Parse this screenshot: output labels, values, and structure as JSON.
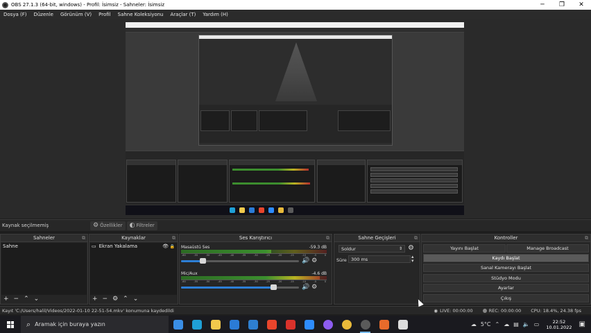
{
  "window": {
    "title": "OBS 27.1.3 (64-bit, windows) - Profil: İsimsiz - Sahneler: İsimsiz",
    "minimize": "─",
    "maximize": "❐",
    "close": "✕"
  },
  "menu": [
    "Dosya (F)",
    "Düzenle",
    "Görünüm (V)",
    "Profil",
    "Sahne Koleksiyonu",
    "Araçlar (T)",
    "Yardım (H)"
  ],
  "sources_strip": {
    "no_source": "Kaynak seçilmemiş",
    "properties": "Özellikler",
    "filters": "Filtreler"
  },
  "docks": {
    "scenes": {
      "title": "Sahneler",
      "items": [
        "Sahne"
      ]
    },
    "sources": {
      "title": "Kaynaklar",
      "items": [
        "Ekran Yakalama"
      ]
    },
    "mixer": {
      "title": "Ses Karıştırıcı",
      "channels": [
        {
          "name": "Masaüstü Ses",
          "db": "-59.3 dB",
          "level": 0.62,
          "volume": 0.18
        },
        {
          "name": "Mic/Aux",
          "db": "-4.6 dB",
          "level": 0.95,
          "volume": 0.78
        }
      ],
      "ticks": [
        "-60",
        "-55",
        "-50",
        "-45",
        "-40",
        "-35",
        "-30",
        "-25",
        "-20",
        "-15",
        "-10",
        "-5",
        "0"
      ]
    },
    "transitions": {
      "title": "Sahne Geçişleri",
      "type": "Soldur",
      "duration_label": "Süre",
      "duration": "300 ms"
    },
    "controls": {
      "title": "Kontroller",
      "start_stream": "Yayını Başlat",
      "manage_broadcast": "Manage Broadcast",
      "start_record": "Kaydı Başlat",
      "virtual_camera": "Sanal Kamerayı Başlat",
      "studio_mode": "Stüdyo Modu",
      "settings": "Ayarlar",
      "exit": "Çıkış"
    }
  },
  "status": {
    "message": "Kayıt 'C:/Users/halil/Videos/2022-01-10 22-51-54.mkv' konumuna kaydedildi",
    "live": "LIVE: 00:00:00",
    "rec": "REC: 00:00:00",
    "cpu": "CPU: 18.4%, 24.38 fps"
  },
  "taskbar": {
    "search_placeholder": "Aramak için buraya yazın",
    "weather": "5°C",
    "time": "22:52",
    "date": "10.01.2022",
    "apps": [
      {
        "name": "task-view",
        "color": "#3a8ee6"
      },
      {
        "name": "edge",
        "color": "#1fa0d6"
      },
      {
        "name": "file-explorer",
        "color": "#f2c94c"
      },
      {
        "name": "store",
        "color": "#2b7bd6"
      },
      {
        "name": "mail",
        "color": "#2e7fd0"
      },
      {
        "name": "office",
        "color": "#e8452c"
      },
      {
        "name": "pdf-reader",
        "color": "#d9322b"
      },
      {
        "name": "zoom",
        "color": "#2d8cff"
      },
      {
        "name": "messenger",
        "color": "#8d5cf0"
      },
      {
        "name": "chrome",
        "color": "#e8b93a"
      },
      {
        "name": "obs",
        "color": "#5a5a5a"
      },
      {
        "name": "app-orange",
        "color": "#e86b2b"
      },
      {
        "name": "screen-app",
        "color": "#dddddd"
      }
    ]
  }
}
